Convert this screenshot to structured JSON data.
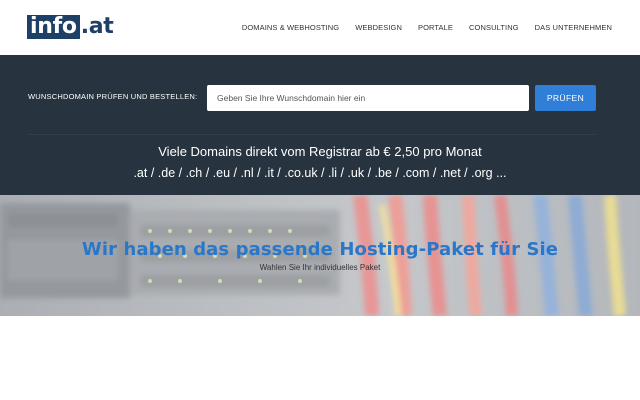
{
  "header": {
    "logo_box": "info",
    "logo_rest": ".at",
    "nav": [
      {
        "label": "DOMAINS & WEBHOSTING"
      },
      {
        "label": "WEBDESIGN"
      },
      {
        "label": "PORTALE"
      },
      {
        "label": "CONSULTING"
      },
      {
        "label": "DAS UNTERNEHMEN"
      }
    ]
  },
  "domain_check": {
    "label": "WUNSCHDOMAIN PRÜFEN UND BESTELLEN:",
    "input_value": "",
    "input_placeholder": "Geben Sie Ihre Wunschdomain hier ein",
    "button_label": "PRÜFEN",
    "button_color": "#2f7ed8",
    "background_color": "#27333f",
    "tagline": "Viele Domains direkt vom Registrar ab € 2,50 pro Monat",
    "tld_list": ".at / .de / .ch / .eu / .nl / .it / .co.uk / .li / .uk / .be / .com / .net / .org ..."
  },
  "hero": {
    "title": "Wir haben das passende Hosting-Paket für Sie",
    "subtitle": "Wahlen Sie Ihr individuelles Paket",
    "title_color": "#2a77c9",
    "background_image": "blurred-server-network-cables-photo"
  }
}
